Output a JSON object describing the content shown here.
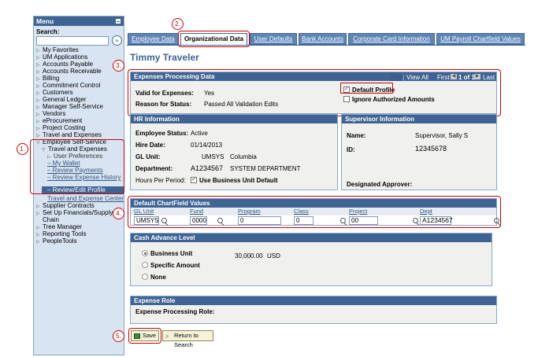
{
  "menu": {
    "title": "Menu",
    "search_label": "Search:",
    "search_go": "»",
    "items": [
      "My Favorites",
      "UM Applications",
      "Accounts Payable",
      "Accounts Receivable",
      "Billing",
      "Commitment Control",
      "Customers",
      "General Ledger",
      "Manager Self-Service",
      "Vendors",
      "eProcurement",
      "Project Costing",
      "Travel and Expenses",
      "Employee Self-Service"
    ],
    "ess_sub": "Travel and Expenses",
    "te_sub": [
      "User Preferences",
      "My Wallet",
      "Review Payments",
      "Review Expense History",
      "Review/Edit Profile"
    ],
    "te_center": "Travel and Expense Center",
    "after": [
      "Supplier Contracts",
      "Set Up Financials/Supply",
      "Chain",
      "Tree Manager",
      "Reporting Tools",
      "PeopleTools"
    ]
  },
  "callouts": [
    "1.",
    "2.",
    "3.",
    "4.",
    "5."
  ],
  "tabs": [
    "Employee Data",
    "Organizational Data",
    "User Defaults",
    "Bank Accounts",
    "Corporate Card Information",
    "UM Payroll Chartfield Values"
  ],
  "person_name": "Timmy Traveler",
  "expenses": {
    "title": "Expenses Processing Data",
    "find": "Find",
    "view_all": "View All",
    "first": "First",
    "of": "1 of 1",
    "last": "Last",
    "valid_label": "Valid for Expenses:",
    "valid_value": "Yes",
    "reason_label": "Reason for Status:",
    "reason_value": "Passed All Validation Edits",
    "default_profile": "Default Profile",
    "ignore_auth": "Ignore Authorized Amounts"
  },
  "hr": {
    "title": "HR Information",
    "status_label": "Employee Status:",
    "status_value": "Active",
    "hire_label": "Hire Date:",
    "hire_value": "01/14/2013",
    "gl_label": "GL Unit:",
    "gl_code": "UMSYS",
    "gl_name": "Columbia",
    "dept_label": "Department:",
    "dept_code": "A1234567",
    "dept_name": "SYSTEM DEPARTMENT",
    "hours_label": "Hours Per Period:",
    "use_bu": "Use Business Unit Default"
  },
  "supervisor": {
    "title": "Supervisor Information",
    "name_label": "Name:",
    "name_value": "Supervisor, Sally S",
    "id_label": "ID:",
    "id_value": "12345678",
    "approver_label": "Designated Approver:"
  },
  "chartfield": {
    "title": "Default ChartField Values",
    "headers": [
      "GL Unit",
      "Fund",
      "Program",
      "Class",
      "Project",
      "Dept"
    ],
    "values": [
      "UMSYS",
      "0000",
      "0",
      "0",
      "00",
      "A1234567"
    ]
  },
  "cash": {
    "title": "Cash Advance Level",
    "bu": "Business Unit",
    "amount": "30,000.00",
    "currency": "USD",
    "specific": "Specific Amount",
    "none": "None"
  },
  "role": {
    "title": "Expense Role",
    "label": "Expense Processing Role:"
  },
  "buttons": {
    "save": "Save",
    "return": "Return to Search"
  }
}
